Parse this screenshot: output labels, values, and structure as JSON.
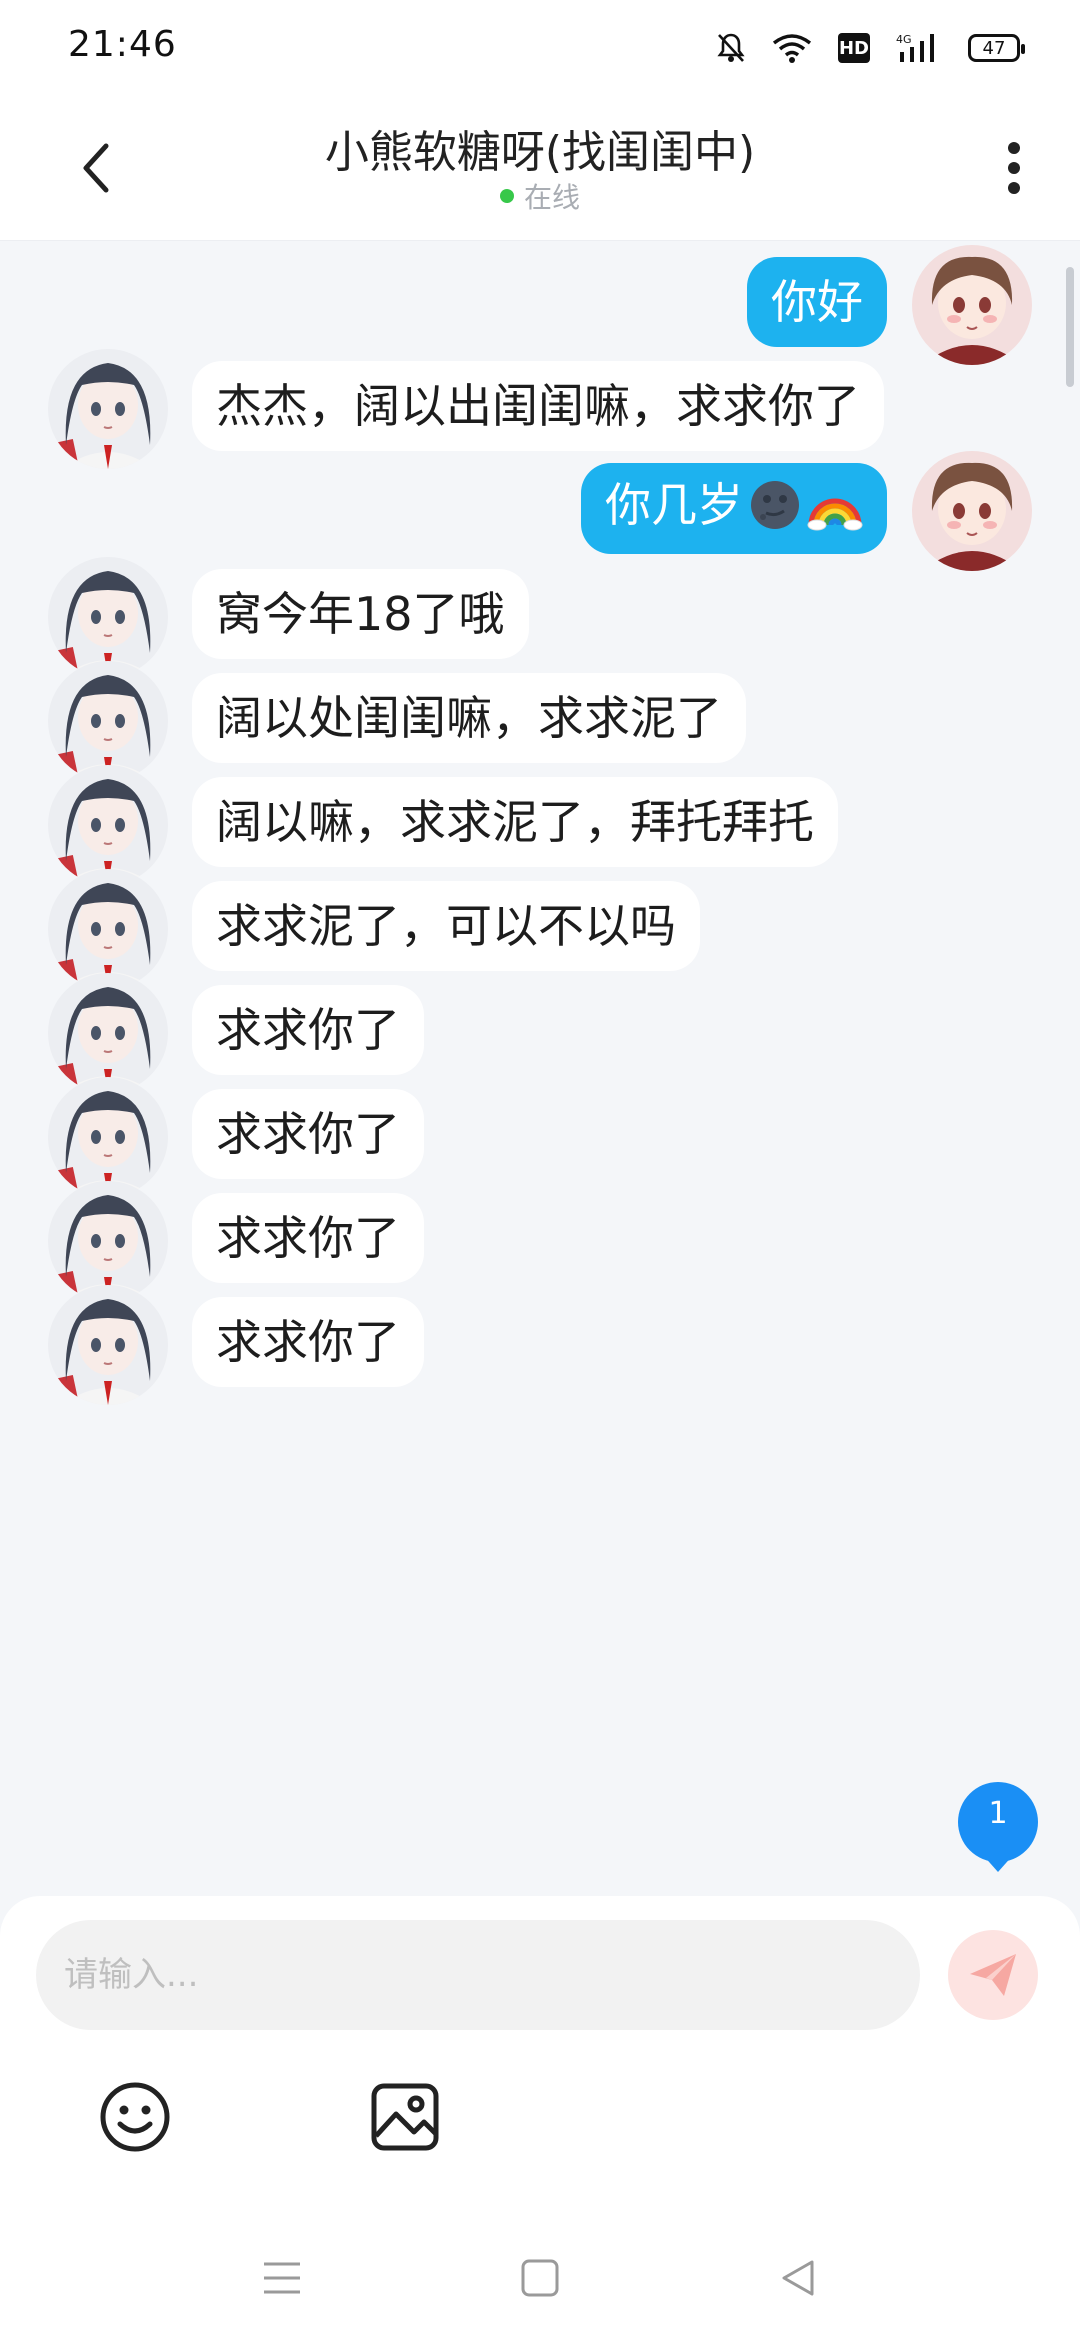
{
  "status_bar": {
    "time": "21:46",
    "icons": [
      "mute-bell-icon",
      "wifi-icon",
      "hd-icon",
      "4g-signal-icon",
      "battery-icon"
    ],
    "hd_label": "HD",
    "network_label": "4G",
    "battery_level": "47"
  },
  "header": {
    "title": "小熊软糖呀(找闺闺中)",
    "status": "在线",
    "status_color": "#37c84a"
  },
  "messages": [
    {
      "side": "out",
      "text": "你好",
      "emojis": []
    },
    {
      "side": "in",
      "text": "杰杰，阔以出闺闺嘛，求求你了",
      "emojis": []
    },
    {
      "side": "out",
      "text": "你几岁",
      "emojis": [
        "new-moon-face-emoji",
        "rainbow-emoji"
      ]
    },
    {
      "side": "in",
      "text": "窝今年18了哦",
      "emojis": []
    },
    {
      "side": "in",
      "text": "阔以处闺闺嘛，求求泥了",
      "emojis": []
    },
    {
      "side": "in",
      "text": "阔以嘛，求求泥了，拜托拜托",
      "emojis": []
    },
    {
      "side": "in",
      "text": "求求泥了，可以不以吗",
      "emojis": []
    },
    {
      "side": "in",
      "text": "求求你了",
      "emojis": []
    },
    {
      "side": "in",
      "text": "求求你了",
      "emojis": []
    },
    {
      "side": "in",
      "text": "求求你了",
      "emojis": []
    },
    {
      "side": "in",
      "text": "求求你了",
      "emojis": []
    }
  ],
  "unread_badge": {
    "count": "1"
  },
  "composer": {
    "placeholder": "请输入...",
    "send_icon": "paper-plane-icon",
    "tools": [
      "smiley-icon",
      "image-icon"
    ]
  },
  "colors": {
    "outgoing_bubble": "#1db2ef",
    "incoming_bubble": "#ffffff",
    "chat_background": "#f4f6f9",
    "badge": "#1a8ff5",
    "send_button": "#fde3e1"
  },
  "nav_bar": {
    "buttons": [
      "menu-icon",
      "home-icon",
      "back-triangle-icon"
    ]
  }
}
